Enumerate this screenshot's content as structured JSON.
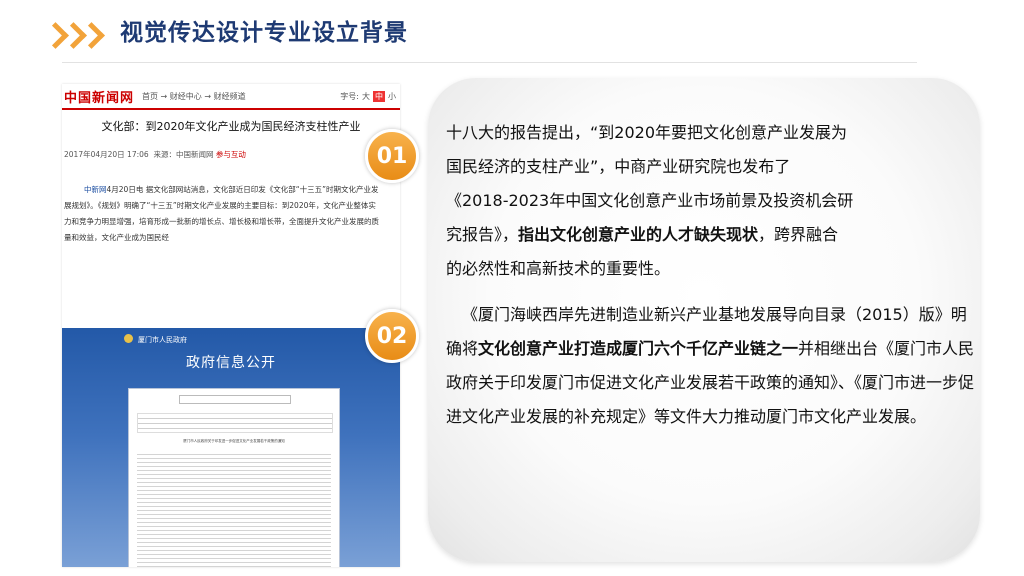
{
  "slide": {
    "title": "视觉传达设计专业设立背景"
  },
  "news": {
    "logo": "中国新闻网",
    "nav": "首页 → 财经中心 → 财经频道",
    "size_label": "字号:",
    "size_large": "大",
    "size_mid": "中",
    "size_small": "小",
    "headline": "文化部：到2020年文化产业成为国民经济支柱性产业",
    "meta_date": "2017年04月20日 17:06",
    "meta_source": "来源：中国新闻网",
    "meta_link": "参与互动",
    "body_source": "中新网",
    "body_text": "4月20日电 据文化部网站消息，文化部近日印发《文化部“十三五”时期文化产业发展规划》。《规划》明确了“十三五”时期文化产业发展的主要目标：到2020年，文化产业整体实力和竞争力明显增强，培育形成一批新的增长点、增长极和增长带，全面提升文化产业发展的质量和效益，文化产业成为国民经"
  },
  "gov": {
    "site_name": "厦门市人民政府",
    "banner_title": "政府信息公开",
    "doc_title": "厦门市人民政府关于印发进一步促进文化产业发展若干政策的通知"
  },
  "points": [
    {
      "num": "01",
      "lines": [
        "十八大的报告提出，“到2020年要把文化创意产业发展为",
        "国民经济的支柱产业”，中商产业研究院也发布了",
        "《2018-2023年中国文化创意产业市场前景及投资机会研",
        "究报告》，",
        "指出文化创意产业的人才缺失现状",
        "，跨界融合",
        "的必然性和高新技术的重要性。"
      ]
    },
    {
      "num": "02",
      "text_a": "《厦门海峡西岸先进制造业新兴产业基地发展导向目录（2015）版》明确将",
      "bold": "文化创意产业打造成厦门六个千亿产业链之一",
      "text_b": "并相继出台《厦门市人民政府关于印发厦门市促进文化产业发展若干政策的通知》、《厦门市进一步促进文化产业发展的补充规定》等文件大力推动厦门市文化产业发展。"
    }
  ]
}
